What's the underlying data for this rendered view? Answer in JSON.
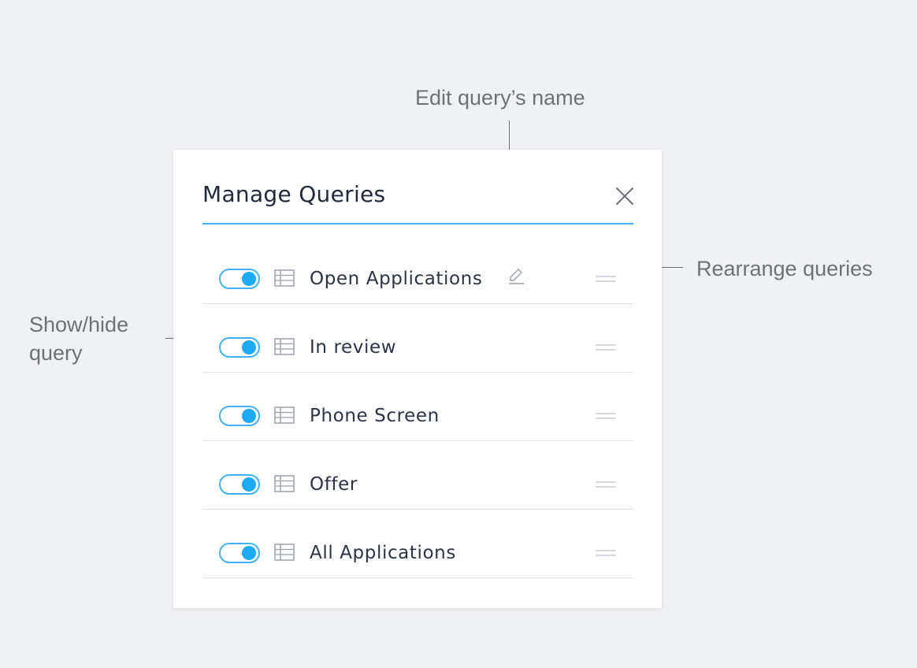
{
  "dialog": {
    "title": "Manage Queries"
  },
  "queries": [
    {
      "label": "Open Applications",
      "visible": true,
      "editing_icon_shown": true
    },
    {
      "label": "In review",
      "visible": true
    },
    {
      "label": "Phone Screen",
      "visible": true
    },
    {
      "label": "Offer",
      "visible": true
    },
    {
      "label": "All Applications",
      "visible": true
    }
  ],
  "annotations": {
    "edit_name": "Edit query’s name",
    "rearrange": "Rearrange queries",
    "show_hide_line1": "Show/hide",
    "show_hide_line2": "query"
  },
  "icons": {
    "close": "close-icon",
    "table": "table-icon",
    "edit": "pencil-icon",
    "drag": "drag-handle-icon"
  },
  "colors": {
    "accent": "#3fb3f4",
    "toggle_knob": "#1eaaf1",
    "title_text": "#1f2a3c",
    "annotation_text": "#6e7176",
    "background": "#f0f1f4"
  }
}
